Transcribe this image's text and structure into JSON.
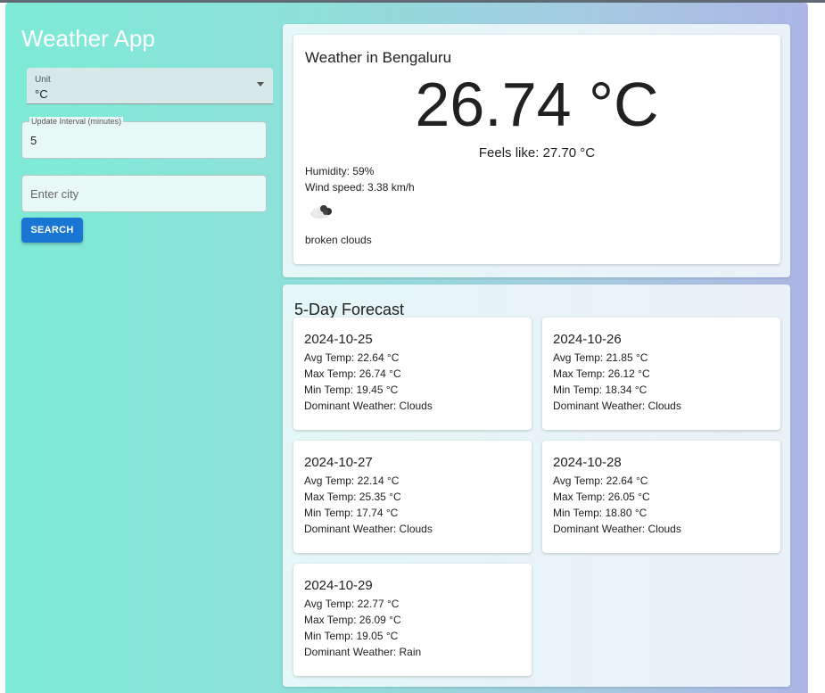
{
  "app": {
    "title": "Weather App"
  },
  "controls": {
    "unit": {
      "label": "Unit",
      "value": "°C"
    },
    "interval": {
      "label": "Update Interval (minutes)",
      "value": "5"
    },
    "city": {
      "placeholder": "Enter city",
      "value": ""
    },
    "search_label": "SEARCH"
  },
  "current": {
    "title": "Weather in Bengaluru",
    "temperature": "26.74 °C",
    "feels_like": "Feels like: 27.70 °C",
    "humidity": "Humidity: 59%",
    "wind": "Wind speed: 3.38 km/h",
    "icon": "broken-clouds-icon",
    "description": "broken clouds"
  },
  "forecast": {
    "title": "5-Day Forecast",
    "days": [
      {
        "date": "2024-10-25",
        "avg": "Avg Temp: 22.64 °C",
        "max": "Max Temp: 26.74 °C",
        "min": "Min Temp: 19.45 °C",
        "weather": "Dominant Weather: Clouds"
      },
      {
        "date": "2024-10-26",
        "avg": "Avg Temp: 21.85 °C",
        "max": "Max Temp: 26.12 °C",
        "min": "Min Temp: 18.34 °C",
        "weather": "Dominant Weather: Clouds"
      },
      {
        "date": "2024-10-27",
        "avg": "Avg Temp: 22.14 °C",
        "max": "Max Temp: 25.35 °C",
        "min": "Min Temp: 17.74 °C",
        "weather": "Dominant Weather: Clouds"
      },
      {
        "date": "2024-10-28",
        "avg": "Avg Temp: 22.64 °C",
        "max": "Max Temp: 26.05 °C",
        "min": "Min Temp: 18.80 °C",
        "weather": "Dominant Weather: Clouds"
      },
      {
        "date": "2024-10-29",
        "avg": "Avg Temp: 22.77 °C",
        "max": "Max Temp: 26.09 °C",
        "min": "Min Temp: 19.05 °C",
        "weather": "Dominant Weather: Rain"
      }
    ]
  },
  "colors": {
    "accent": "#1976d2",
    "gradient_start": "#7debd6",
    "gradient_end": "#adb6e5"
  }
}
